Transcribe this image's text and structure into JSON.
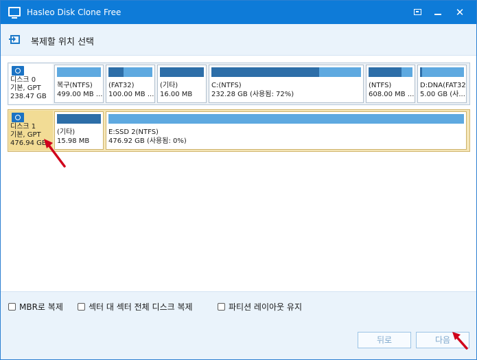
{
  "window": {
    "title": "Hasleo Disk Clone Free"
  },
  "header": {
    "title": "복제할 위치 선택"
  },
  "disks": [
    {
      "name": "디스크 0",
      "type": "기본, GPT",
      "size": "238.47 GB",
      "selected": false,
      "partitions": [
        {
          "name": "복구(NTFS)",
          "size": "499.00 MB ...",
          "used_fraction": 0.0
        },
        {
          "name": "(FAT32)",
          "size": "100.00 MB ...",
          "used_fraction": 0.35
        },
        {
          "name": "(기타)",
          "size": "16.00 MB",
          "used_fraction": 1.0
        },
        {
          "name": "C:(NTFS)",
          "size": "232.28 GB (사용됨: 72%)",
          "used_fraction": 0.72
        },
        {
          "name": "(NTFS)",
          "size": "608.00 MB ...",
          "used_fraction": 0.75
        },
        {
          "name": "D:DNA(FAT32",
          "size": "5.00 GB (사...",
          "used_fraction": 0.05
        }
      ]
    },
    {
      "name": "디스크 1",
      "type": "기본, GPT",
      "size": "476.94 GB",
      "selected": true,
      "partitions": [
        {
          "name": "(기타)",
          "size": "15.98 MB",
          "used_fraction": 1.0
        },
        {
          "name": "E:SSD 2(NTFS)",
          "size": "476.92 GB (사용됨: 0%)",
          "used_fraction": 0.0
        }
      ]
    }
  ],
  "options": {
    "mbr_copy": {
      "label": "MBR로 복제",
      "checked": false
    },
    "sector_by_sector": {
      "label": "섹터 대 섹터 전체 디스크 복제",
      "checked": false
    },
    "keep_layout": {
      "label": "파티션 레이아웃 유지",
      "checked": false
    }
  },
  "footer": {
    "back_label": "뒤로",
    "next_label": "다음"
  },
  "colors": {
    "titlebar": "#0e7bd8",
    "bar_free": "#5ea9e0",
    "bar_used": "#2d6ea8",
    "selected_row": "#f5e6b8",
    "annotation_arrow": "#d0021b"
  },
  "icons": {
    "app": "monitor-icon",
    "menu": "menu-icon",
    "minimize": "minimize-icon",
    "close": "close-icon",
    "step": "import-icon",
    "disk": "disk-icon"
  }
}
